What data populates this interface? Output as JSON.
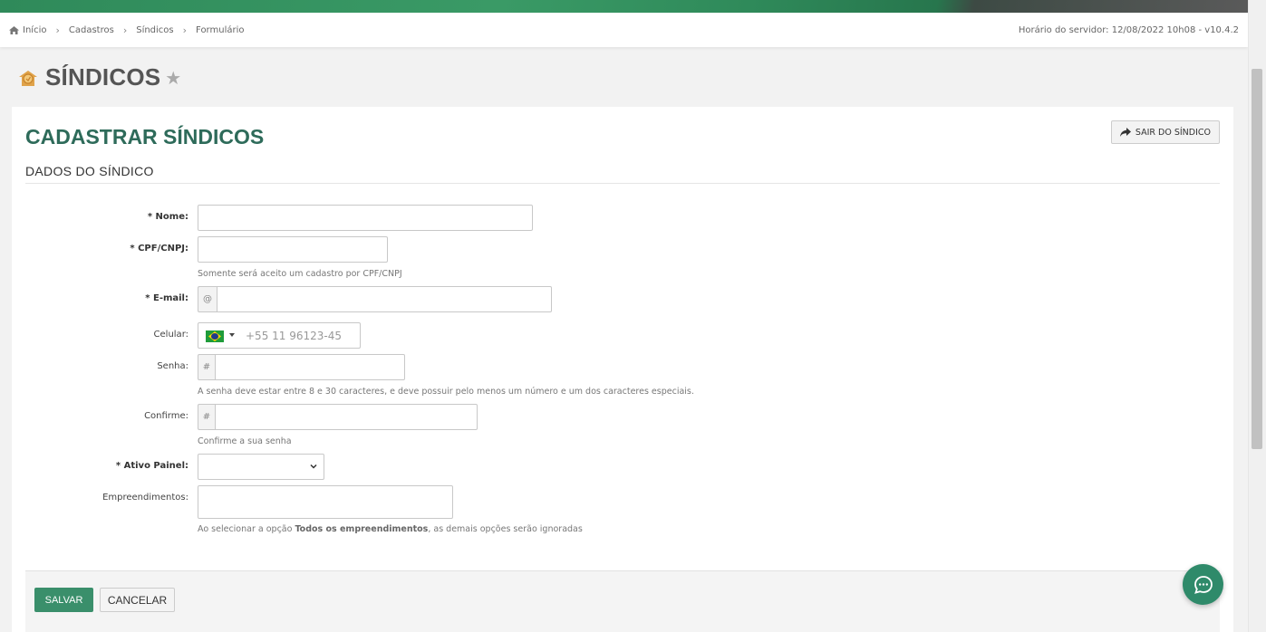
{
  "breadcrumb": {
    "items": [
      "Início",
      "Cadastros",
      "Síndicos",
      "Formulário"
    ],
    "server_time": "Horário do servidor: 12/08/2022 10h08 - v10.4.2"
  },
  "page": {
    "title": "SÍNDICOS"
  },
  "panel": {
    "title": "CADASTRAR SÍNDICOS",
    "exit_label": "SAIR DO SÍNDICO",
    "section_title": "DADOS DO SÍNDICO"
  },
  "form": {
    "nome_label": "Nome:",
    "cpf_label": "CPF/CNPJ:",
    "cpf_help": "Somente será aceito um cadastro por CPF/CNPJ",
    "email_label": "E-mail:",
    "email_addon": "@",
    "celular_label": "Celular:",
    "celular_placeholder": "+55 11 96123-45",
    "senha_label": "Senha:",
    "senha_addon": "#",
    "senha_help": "A senha deve estar entre 8 e 30 caracteres, e deve possuir pelo menos um número e um dos caracteres especiais.",
    "confirme_label": "Confirme:",
    "confirme_addon": "#",
    "confirme_help": "Confirme a sua senha",
    "ativo_label": "Ativo Painel:",
    "empreendimentos_label": "Empreendimentos:",
    "empreendimentos_help_pre": "Ao selecionar a opção ",
    "empreendimentos_help_bold": "Todos os empreendimentos",
    "empreendimentos_help_post": ", as demais opções serão ignoradas",
    "required_mark": "*"
  },
  "actions": {
    "save": "SALVAR",
    "cancel": "CANCELAR"
  },
  "colors": {
    "brand_green": "#3a8f6b",
    "title_green": "#2e6b5a"
  },
  "icons": [
    "home-icon",
    "chevron-right-icon",
    "trophy-icon",
    "star-icon",
    "share-arrow-icon",
    "brazil-flag-icon",
    "chevron-down-icon",
    "chat-icon"
  ]
}
